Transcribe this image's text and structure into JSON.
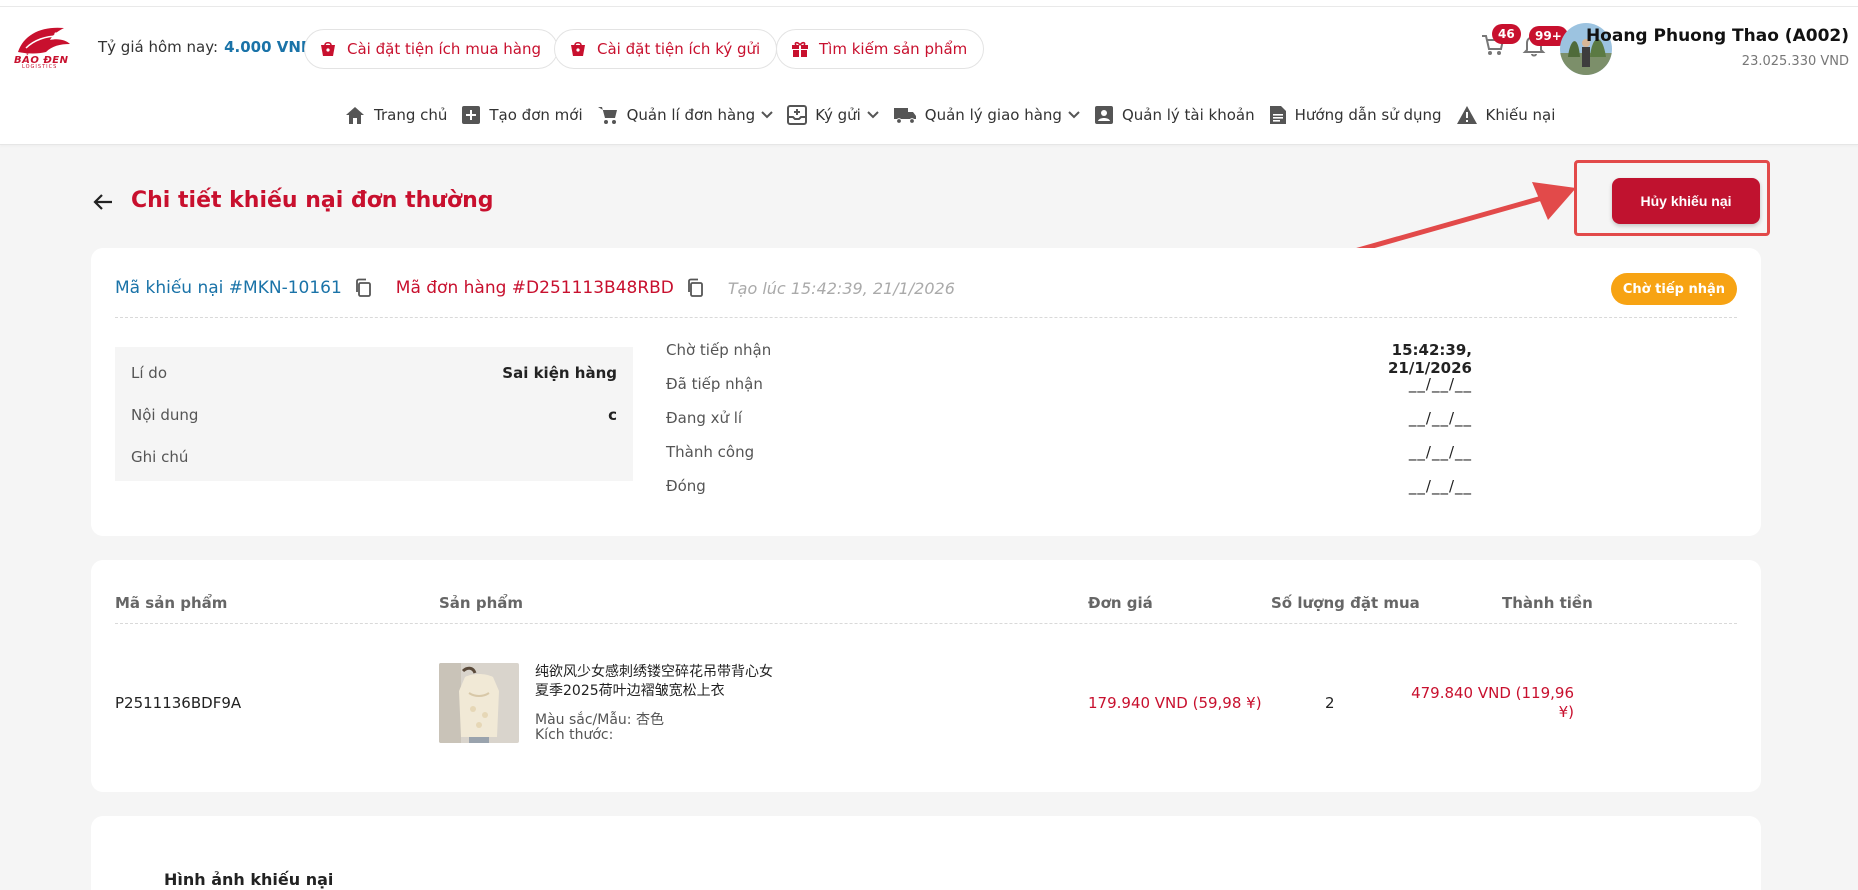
{
  "header": {
    "logo_text": "BẢO ĐEN",
    "logo_sub": "LOGISTICS",
    "rate_label": "Tỷ giá hôm nay:",
    "rate_value": "4.000 VND",
    "quick_links": [
      {
        "label": "Cài đặt tiện ích mua hàng",
        "icon": "cart-box-icon"
      },
      {
        "label": "Cài đặt tiện ích ký gửi",
        "icon": "cart-box-icon"
      },
      {
        "label": "Tìm kiếm sản phẩm",
        "icon": "gift-icon"
      }
    ],
    "cart_count": "46",
    "notif_count": "99+",
    "user_name": "Hoang Phuong Thao (A002)",
    "user_balance": "23.025.330 VND"
  },
  "nav": [
    {
      "label": "Trang chủ",
      "icon": "home-icon",
      "dropdown": false
    },
    {
      "label": "Tạo đơn mới",
      "icon": "plus-square-icon",
      "dropdown": false
    },
    {
      "label": "Quản lí đơn hàng",
      "icon": "cart-icon",
      "dropdown": true
    },
    {
      "label": "Ký gửi",
      "icon": "deposit-icon",
      "dropdown": true
    },
    {
      "label": "Quản lý giao hàng",
      "icon": "truck-icon",
      "dropdown": true
    },
    {
      "label": "Quản lý tài khoản",
      "icon": "account-icon",
      "dropdown": false
    },
    {
      "label": "Hướng dẫn sử dụng",
      "icon": "document-icon",
      "dropdown": false
    },
    {
      "label": "Khiếu nại",
      "icon": "warning-icon",
      "dropdown": false
    }
  ],
  "page": {
    "title": "Chi tiết khiếu nại đơn thường",
    "cancel_label": "Hủy khiếu nại"
  },
  "complaint": {
    "complaint_code": "Mã khiếu nại #MKN-10161",
    "order_code": "Mã đơn hàng #D251113B48RBD",
    "created": "Tạo lúc 15:42:39, 21/1/2026",
    "status": "Chờ tiếp nhận",
    "info": [
      {
        "key": "Lí do",
        "value": "Sai kiện hàng"
      },
      {
        "key": "Nội dung",
        "value": "c"
      },
      {
        "key": "Ghi chú",
        "value": ""
      }
    ],
    "timeline": [
      {
        "key": "Chờ tiếp nhận",
        "value": "15:42:39, 21/1/2026"
      },
      {
        "key": "Đã tiếp nhận",
        "value": "__/__/__"
      },
      {
        "key": "Đang xử lí",
        "value": "__/__/__"
      },
      {
        "key": "Thành công",
        "value": "__/__/__"
      },
      {
        "key": "Đóng",
        "value": "__/__/__"
      }
    ]
  },
  "products": {
    "headers": [
      "Mã sản phẩm",
      "Sản phẩm",
      "Đơn giá",
      "Số lượng đặt mua",
      "Thành tiền"
    ],
    "rows": [
      {
        "code": "P2511136BDF9A",
        "name": "纯欲风少女感刺绣镂空碎花吊带背心女夏季2025荷叶边褶皱宽松上衣",
        "color": "Màu sắc/Mẫu: 杏色",
        "size": "Kích thước:",
        "unit_price": "179.940 VND (59,98 ¥)",
        "quantity": "2",
        "total": "479.840 VND (119,96 ¥)"
      }
    ]
  },
  "images_section": {
    "title": "Hình ảnh khiếu nại"
  },
  "colors": {
    "brand_red": "#c8102e",
    "link_blue": "#1a73a8",
    "status_orange": "#f7a313"
  }
}
